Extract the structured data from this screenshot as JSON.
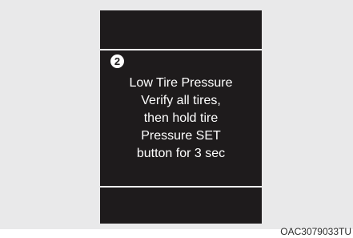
{
  "display": {
    "marker": "2",
    "message_lines": [
      "Low Tire Pressure",
      "Verify all tires,",
      "then hold tire",
      "Pressure SET",
      "button for 3 sec"
    ]
  },
  "figure_code": "OAC3079033TU"
}
